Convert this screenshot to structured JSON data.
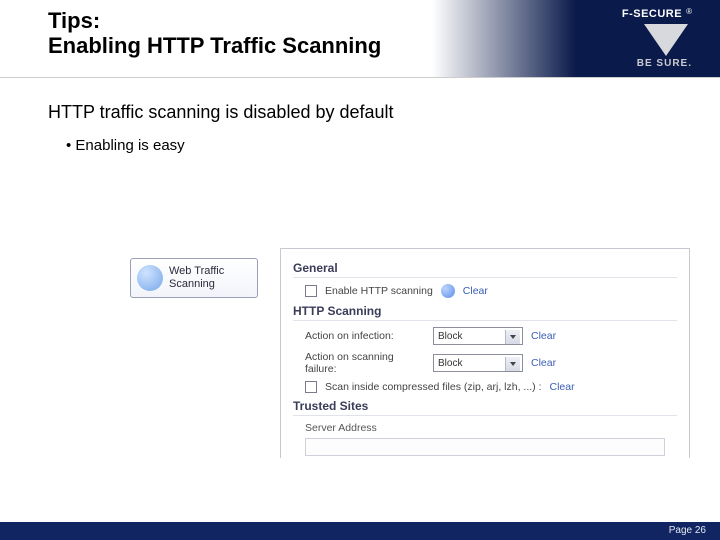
{
  "header": {
    "line1": "Tips:",
    "line2": "Enabling HTTP Traffic Scanning",
    "brand": "F-SECURE",
    "reg": "®",
    "tagline": "BE SURE."
  },
  "content": {
    "subheading": "HTTP traffic scanning is disabled by default",
    "bullet1": "Enabling is easy"
  },
  "btn_card": {
    "line1": "Web Traffic",
    "line2": "Scanning"
  },
  "panel": {
    "section_general": "General",
    "enable_http_label": "Enable HTTP scanning",
    "clear": "Clear",
    "section_scanning": "HTTP Scanning",
    "action_infection_label": "Action on infection:",
    "action_failure_label": "Action on scanning failure:",
    "block_value": "Block",
    "compressed_label": "Scan inside compressed files (zip, arj, lzh, ...) :",
    "section_trusted": "Trusted Sites",
    "col_server": "Server Address"
  },
  "footer": {
    "page": "Page 26"
  }
}
